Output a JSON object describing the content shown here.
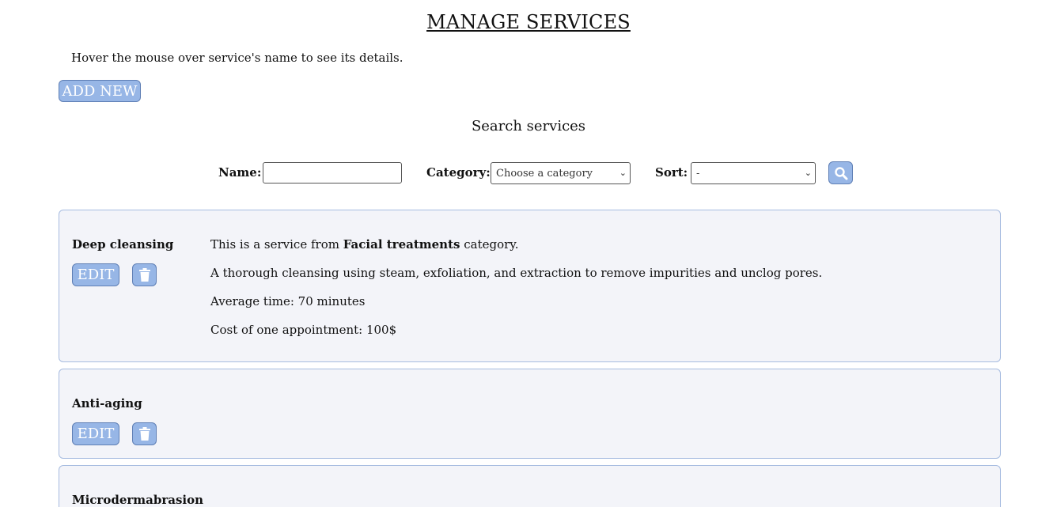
{
  "page": {
    "title": "MANAGE SERVICES",
    "hint": "Hover the mouse over service's name to see its details.",
    "add_new_label": "ADD NEW"
  },
  "search": {
    "title": "Search services",
    "name_label": "Name:",
    "name_value": "",
    "category_label": "Category:",
    "category_selected": "Choose a category",
    "sort_label": "Sort:",
    "sort_selected": "-",
    "search_icon": "search-icon"
  },
  "services": [
    {
      "name": "Deep cleansing",
      "edit_label": "EDIT",
      "delete_icon": "trash-icon",
      "details": {
        "category_prefix": "This is a service from ",
        "category": "Facial treatments",
        "category_suffix": " category.",
        "description": "A thorough cleansing using steam, exfoliation, and extraction to remove impurities and unclog pores.",
        "avg_time": "Average time: 70 minutes",
        "cost": "Cost of one appointment: 100$"
      }
    },
    {
      "name": "Anti-aging",
      "edit_label": "EDIT",
      "delete_icon": "trash-icon"
    },
    {
      "name": "Microdermabrasion"
    }
  ],
  "colors": {
    "button_bg": "#97b6e6",
    "card_bg": "#f3f4f9",
    "card_border": "#a7bce0"
  }
}
